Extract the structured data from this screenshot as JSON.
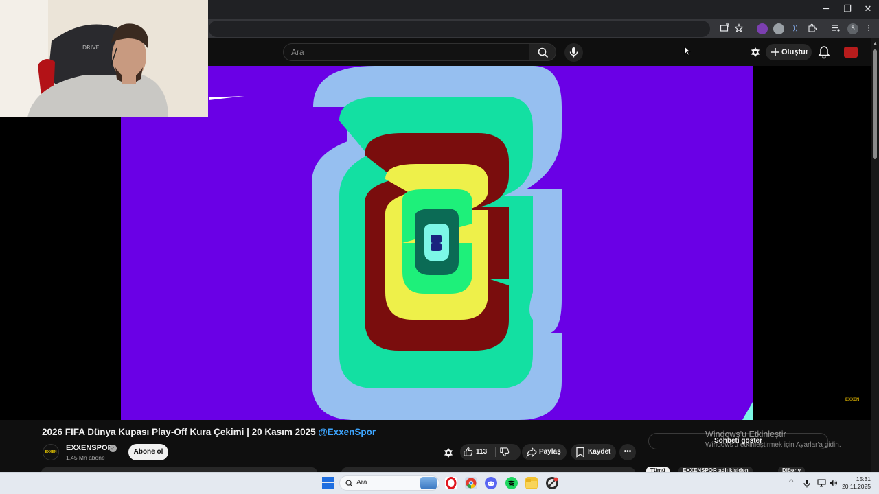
{
  "window": {
    "controls": {
      "minimize": "─",
      "maximize": "❐",
      "close": "✕"
    }
  },
  "youtube_header": {
    "search_placeholder": "Ara",
    "create_label": "Oluştur"
  },
  "video": {
    "title": "2026 FIFA Dünya Kupası Play-Off Kura Çekimi | 20 Kasım 2025",
    "title_handle": "@ExxenSpor",
    "brand_tag": "EXXEN"
  },
  "channel": {
    "name": "EXXENSPOR",
    "subscribers": "1,45 Mn abone",
    "subscribe_label": "Abone ol",
    "avatar_text": "EXXEN"
  },
  "actions": {
    "like_count": "113",
    "share_label": "Paylaş",
    "save_label": "Kaydet",
    "more_label": "•••"
  },
  "chat": {
    "show_chat_label": "Sohbeti göster"
  },
  "windows_watermark": {
    "line1": "Windows'u Etkinleştir",
    "line2": "Windows'u etkinleştirmek için Ayarlar'a gidin."
  },
  "chips": [
    "Tümü",
    "EXXENSPOR adlı kişiden",
    "Diğer v"
  ],
  "taskbar": {
    "search_placeholder": "Ara",
    "time": "15:31",
    "date": "20.11.2025"
  },
  "colors": {
    "frame_bg": "#6a00e6",
    "light_blue": "#96bff0",
    "mint": "#13e0a2",
    "maroon": "#7a0d0d",
    "yellow": "#eef04a",
    "green": "#1ef07a",
    "dark_green": "#0b6b55",
    "cyan": "#7cf7e6",
    "navy": "#1a237e"
  }
}
